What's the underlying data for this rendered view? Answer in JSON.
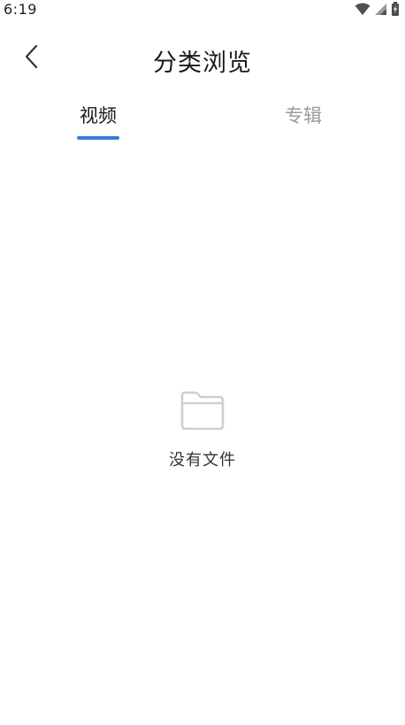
{
  "status_bar": {
    "time": "6:19"
  },
  "header": {
    "title": "分类浏览",
    "back_icon": "chevron-left-icon"
  },
  "tabs": [
    {
      "label": "视频",
      "active": true
    },
    {
      "label": "专辑",
      "active": false
    }
  ],
  "empty_state": {
    "icon": "folder-icon",
    "message": "没有文件"
  },
  "colors": {
    "accent": "#3a7bd5",
    "active_tab_text": "#1a1a1a",
    "inactive_tab_text": "#9a9a9a",
    "empty_icon": "#cfcfcf"
  }
}
